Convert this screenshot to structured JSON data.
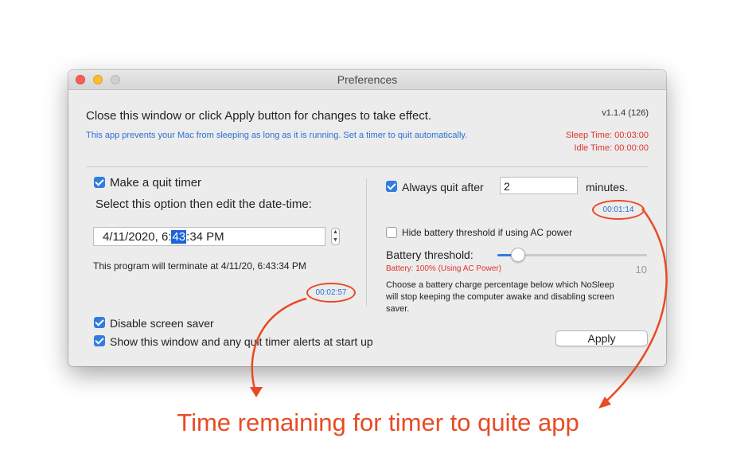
{
  "window": {
    "title": "Preferences",
    "header": "Close this window or click Apply button for changes to take effect.",
    "version": "v1.1.4 (126)",
    "description": "This app prevents your Mac from sleeping as long as it is running. Set a timer to quit automatically.",
    "sleep_time": "Sleep Time: 00:03:00",
    "idle_time": "Idle Time: 00:00:00"
  },
  "left": {
    "quit_timer_label": "Make a quit timer",
    "quit_timer_checked": true,
    "instruction": "Select this option then edit the date-time:",
    "date_before": "4/11/2020,   6:",
    "date_selected": "43",
    "date_after": ":34 PM",
    "terminate_text": "This program will terminate at 4/11/20, 6:43:34 PM",
    "countdown": "00:02:57",
    "disable_screensaver_label": "Disable screen saver",
    "disable_screensaver_checked": true,
    "show_window_label": "Show this window and any quit timer alerts at start up",
    "show_window_checked": true
  },
  "right": {
    "always_quit_label": "Always quit after",
    "always_quit_checked": true,
    "minutes_value": "2",
    "minutes_label": "minutes.",
    "countdown": "00:01:14",
    "hide_battery_label": "Hide battery threshold if using AC power",
    "hide_battery_checked": false,
    "battery_threshold_label": "Battery threshold:",
    "slider_max_label": "10",
    "slider_level_fraction": 0.14,
    "battery_status": "Battery: 100% (Using AC Power)",
    "battery_desc": "Choose a battery charge percentage below which NoSleep will stop keeping the computer awake and disabling screen saver.",
    "apply_label": "Apply"
  },
  "annotation": {
    "text": "Time remaining for timer to quite app",
    "color": "#e84b24"
  },
  "colors": {
    "accent": "#2f7de1",
    "warning": "#e0332b",
    "link_blue": "#2b6fd3"
  }
}
